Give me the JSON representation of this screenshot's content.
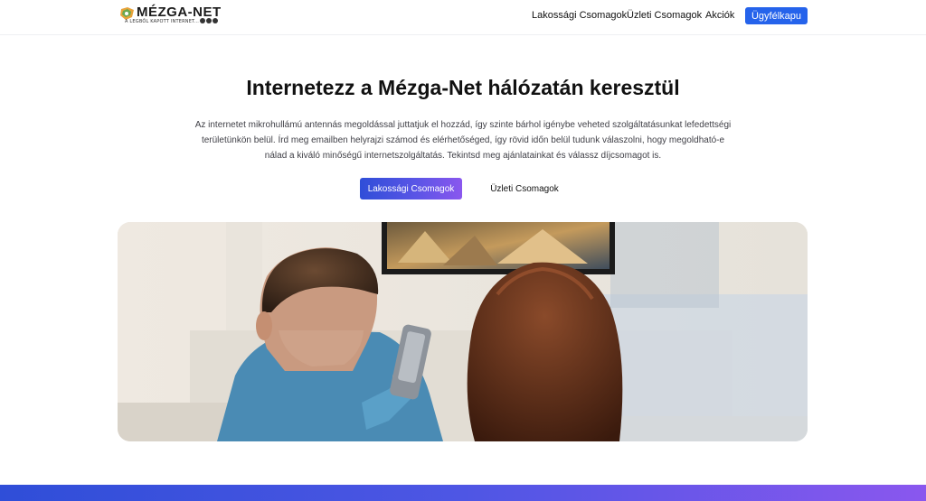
{
  "brand": {
    "name": "MÉZGA-NET",
    "tagline": "A LEGBŐL KAPOTT INTERNET..."
  },
  "nav": {
    "items": [
      {
        "label": "Lakossági Csomagok"
      },
      {
        "label": "Üzleti Csomagok"
      },
      {
        "label": "Akciók"
      }
    ],
    "portal_label": "Ügyfélkapu"
  },
  "hero": {
    "title": "Internetezz a Mézga-Net hálózatán keresztül",
    "text": "Az internetet mikrohullámú antennás megoldással juttatjuk el hozzád, így szinte bárhol igénybe veheted szolgáltatásunkat lefedettségi területünkön belül. Írd meg emailben helyrajzi számod és elérhetőséged, így rövid időn belül tudunk válaszolni, hogy megoldható-e nálad a kiváló minőségű internetszolgáltatás. Tekintsd meg ajánlatainkat és válassz díjcsomagot is.",
    "primary_cta": "Lakossági Csomagok",
    "secondary_cta": "Üzleti Csomagok"
  },
  "colors": {
    "accent": "#2563eb",
    "gradient_start": "#2f4ed8",
    "gradient_end": "#8a57ee"
  }
}
